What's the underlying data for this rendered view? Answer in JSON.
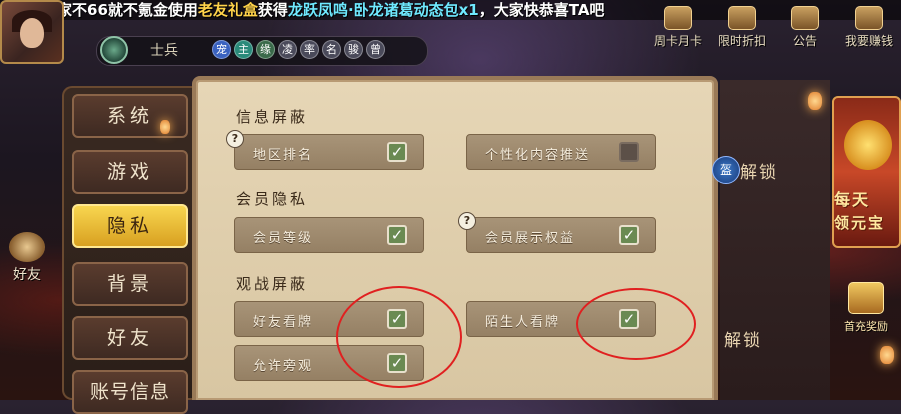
{
  "marquee": {
    "segments": [
      {
        "text": "玩家",
        "color": "white"
      },
      {
        "text": "不66就不氪金",
        "color": "white"
      },
      {
        "text": "使用",
        "color": "white"
      },
      {
        "text": "老友礼盒",
        "color": "gold"
      },
      {
        "text": "获得",
        "color": "white"
      },
      {
        "text": "龙跃凤鸣·卧龙诸葛动态包x1",
        "color": "cyan"
      },
      {
        "text": "，大家快恭喜TA吧",
        "color": "white"
      }
    ]
  },
  "rank": {
    "name": "士兵",
    "privileges": [
      "宠",
      "主",
      "缘",
      "凌",
      "率",
      "名",
      "骏",
      "曾"
    ]
  },
  "top_buttons": [
    "周卡月卡",
    "限时折扣",
    "公告",
    "我要赚钱"
  ],
  "left_friend_button": "好友",
  "menu": {
    "items": [
      "系统",
      "游戏",
      "隐私",
      "背景",
      "好友",
      "账号信息"
    ],
    "active_index": 2
  },
  "privacy": {
    "sections": [
      {
        "title": "信息屏蔽",
        "options": [
          {
            "label": "地区排名",
            "checked": true,
            "has_help": true
          },
          {
            "label": "个性化内容推送",
            "checked": false,
            "has_help": false
          }
        ]
      },
      {
        "title": "会员隐私",
        "options": [
          {
            "label": "会员等级",
            "checked": true,
            "has_help": false
          },
          {
            "label": "会员展示权益",
            "checked": true,
            "has_help": true
          }
        ]
      },
      {
        "title": "观战屏蔽",
        "options": [
          {
            "label": "好友看牌",
            "checked": true,
            "has_help": false
          },
          {
            "label": "陌生人看牌",
            "checked": true,
            "has_help": false
          },
          {
            "label": "允许旁观",
            "checked": true,
            "has_help": false
          }
        ]
      }
    ],
    "help_glyph": "?",
    "check_glyph": "✓"
  },
  "right_side": {
    "unlock_label": "解锁",
    "lock_badge": "盔",
    "daily_line1": "每天",
    "daily_line2": "领元宝",
    "first_charge": "首充奖励"
  },
  "colors": {
    "accent_gold": "#f8d650",
    "annotation_red": "#e02020",
    "check_green": "#6a8a52"
  }
}
